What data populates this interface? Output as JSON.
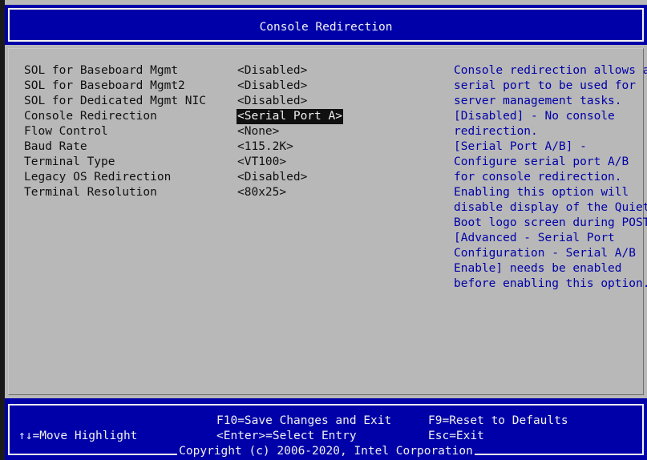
{
  "title": "Console Redirection",
  "options": [
    {
      "label": "SOL for Baseboard Mgmt",
      "value": "<Disabled>"
    },
    {
      "label": "SOL for Baseboard Mgmt2",
      "value": "<Disabled>"
    },
    {
      "label": "SOL for Dedicated Mgmt NIC",
      "value": "<Disabled>"
    },
    {
      "label": "Console Redirection",
      "value": "<Serial Port A>"
    },
    {
      "label": "Flow Control",
      "value": "<None>"
    },
    {
      "label": "Baud Rate",
      "value": "<115.2K>"
    },
    {
      "label": "Terminal Type",
      "value": "<VT100>"
    },
    {
      "label": "Legacy OS Redirection",
      "value": "<Disabled>"
    },
    {
      "label": "Terminal Resolution",
      "value": "<80x25>"
    }
  ],
  "selected_option": "Console Redirection",
  "help_lines": [
    "Console redirection allows a",
    "serial port to be used for",
    "server management tasks.",
    "[Disabled] - No console",
    "redirection.",
    "[Serial Port A/B] -",
    "Configure serial port A/B",
    "for console redirection.",
    "Enabling this option will",
    "disable display of the Quiet",
    "Boot logo screen during POST.",
    "[Advanced - Serial Port",
    "Configuration - Serial A/B",
    "Enable] needs be enabled",
    "before enabling this option."
  ],
  "footer": {
    "move_highlight": "↑↓=Move Highlight",
    "save_exit": "F10=Save Changes and Exit",
    "select_entry": "<Enter>=Select Entry",
    "reset_defaults": "F9=Reset to Defaults",
    "esc_exit": "Esc=Exit",
    "copyright": "Copyright (c) 2006-2020, Intel Corporation"
  },
  "colors": {
    "bios_blue": "#0000a8",
    "panel_gray": "#b8b8b8",
    "text_white": "#f0f0f0",
    "text_dark": "#101010"
  }
}
